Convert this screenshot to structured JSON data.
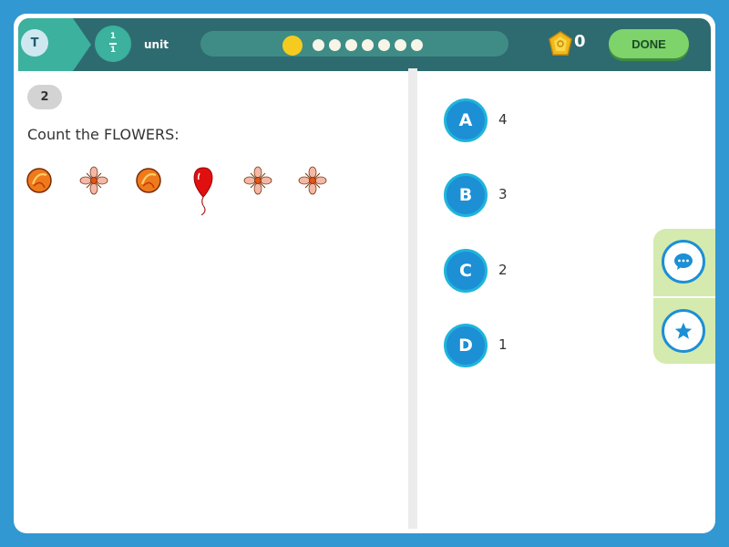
{
  "topbar": {
    "user_initial": "T",
    "unit_fraction": {
      "numerator": "1",
      "denominator": "1"
    },
    "unit_label": "unit",
    "progress": {
      "total": 8,
      "current": 1
    },
    "score": "0",
    "done_label": "DONE"
  },
  "question": {
    "number": "2",
    "text": "Count the FLOWERS:",
    "items": [
      "orange-fruit-icon",
      "flower-icon",
      "orange-fruit-icon",
      "balloon-icon",
      "flower-icon",
      "flower-icon"
    ]
  },
  "answers": [
    {
      "letter": "A",
      "value": "4"
    },
    {
      "letter": "B",
      "value": "3"
    },
    {
      "letter": "C",
      "value": "2"
    },
    {
      "letter": "D",
      "value": "1"
    }
  ],
  "side_tools": [
    "chat-icon",
    "star-icon"
  ],
  "colors": {
    "topbar": "#2e6b70",
    "accent_teal": "#3bb19e",
    "answer_blue": "#1c8fd5",
    "done_green": "#7ed36a",
    "progress_current": "#f5cb1f"
  }
}
